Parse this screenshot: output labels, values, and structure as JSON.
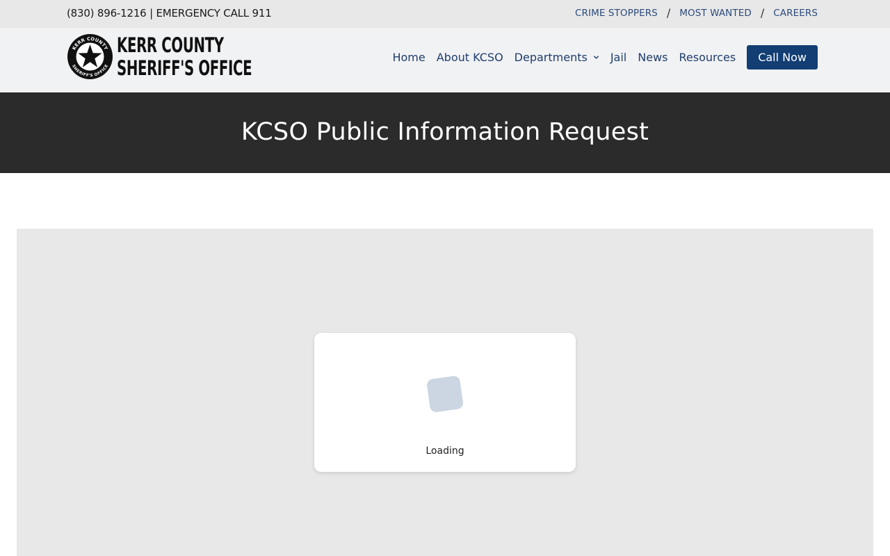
{
  "topbar": {
    "contact": "(830) 896-1216 | EMERGENCY CALL 911",
    "links": [
      "CRIME STOPPERS",
      "MOST WANTED",
      "CAREERS"
    ],
    "separator": "/"
  },
  "logo": {
    "line1": "KERR COUNTY",
    "line2": "SHERIFF'S OFFICE",
    "badge_ring_top": "KERR COUNTY",
    "badge_ring_bottom": "SHERIFF'S OFFICE"
  },
  "nav": {
    "home": "Home",
    "about": "About KCSO",
    "departments": "Departments",
    "jail": "Jail",
    "news": "News",
    "resources": "Resources",
    "call_now": "Call Now"
  },
  "hero": {
    "title": "KCSO Public Information Request"
  },
  "loader": {
    "label": "Loading"
  },
  "colors": {
    "topbar_bg": "#e8e8e8",
    "header_bg": "#f1f2f4",
    "nav_text": "#1f3d6b",
    "button_bg": "#123e74",
    "hero_bg": "#2b2b2b",
    "frame_bg": "#e8e8e8",
    "spinner": "#cbd6e2"
  }
}
